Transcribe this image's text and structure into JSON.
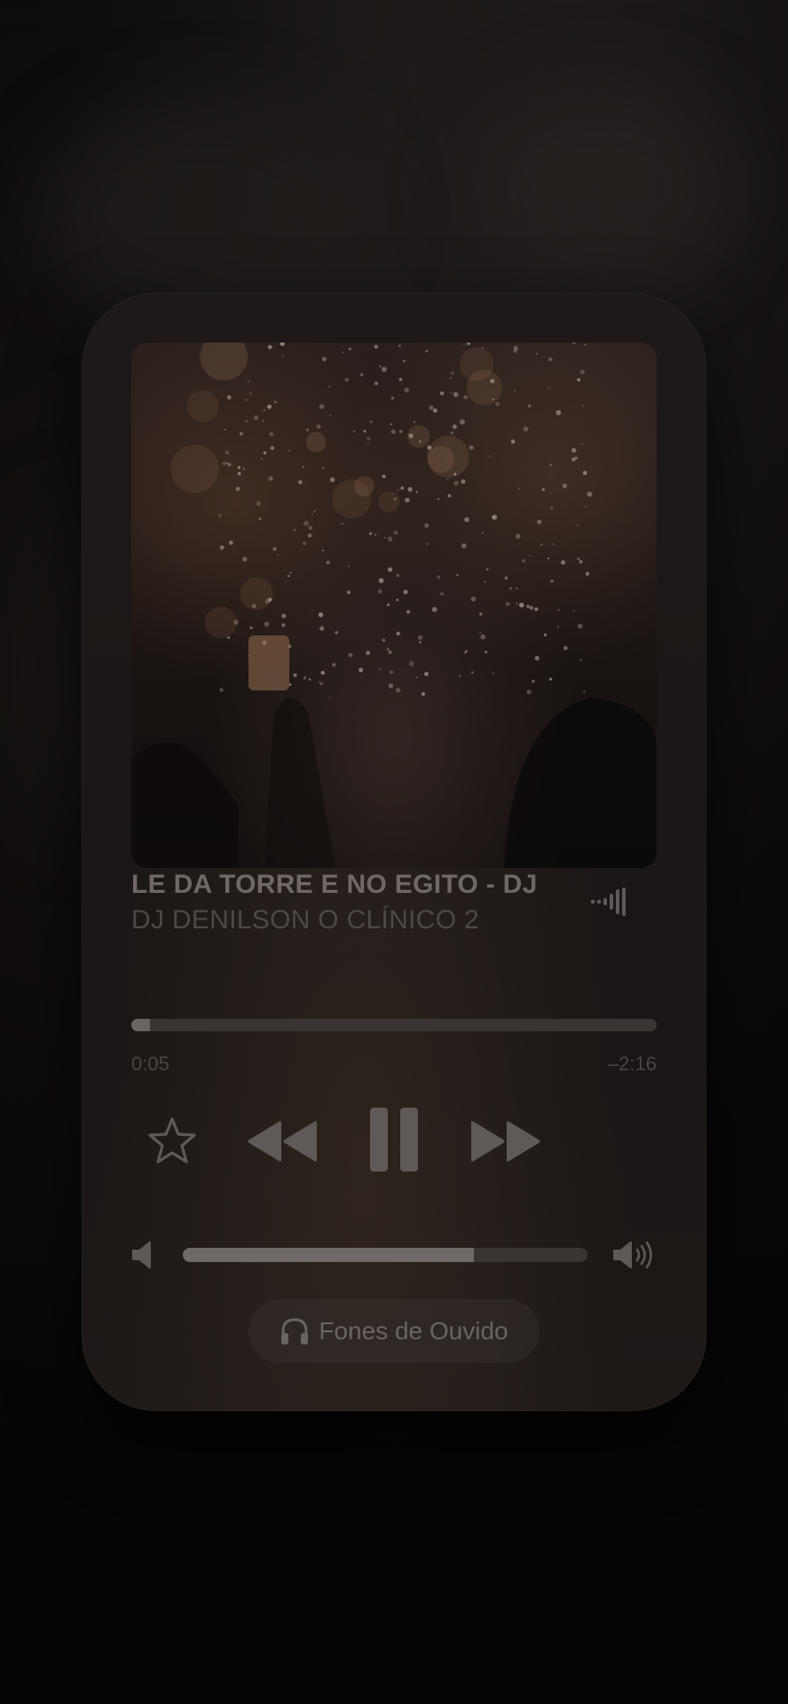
{
  "player": {
    "track_title": "LE DA TORRE E NO EGITO - DJ",
    "track_artist": "DJ DENILSON O CLÍNICO 2",
    "elapsed_time": "0:05",
    "remaining_time": "–2:16",
    "progress_fraction": 0.035,
    "volume_fraction": 0.72,
    "output_device_label": "Fones de Ouvido"
  },
  "colors": {
    "card_background": "#1c1817",
    "icon_color": "#5f5957",
    "text_primary": "#6f6866",
    "text_secondary": "#4e4846"
  },
  "icons": {
    "favorite": "star-icon",
    "previous": "rewind-icon",
    "pause": "pause-icon",
    "next": "fast-forward-icon",
    "airplay": "audio-output-icon",
    "volume_low": "speaker-low-icon",
    "volume_high": "speaker-high-icon",
    "headphones": "headphones-icon"
  }
}
